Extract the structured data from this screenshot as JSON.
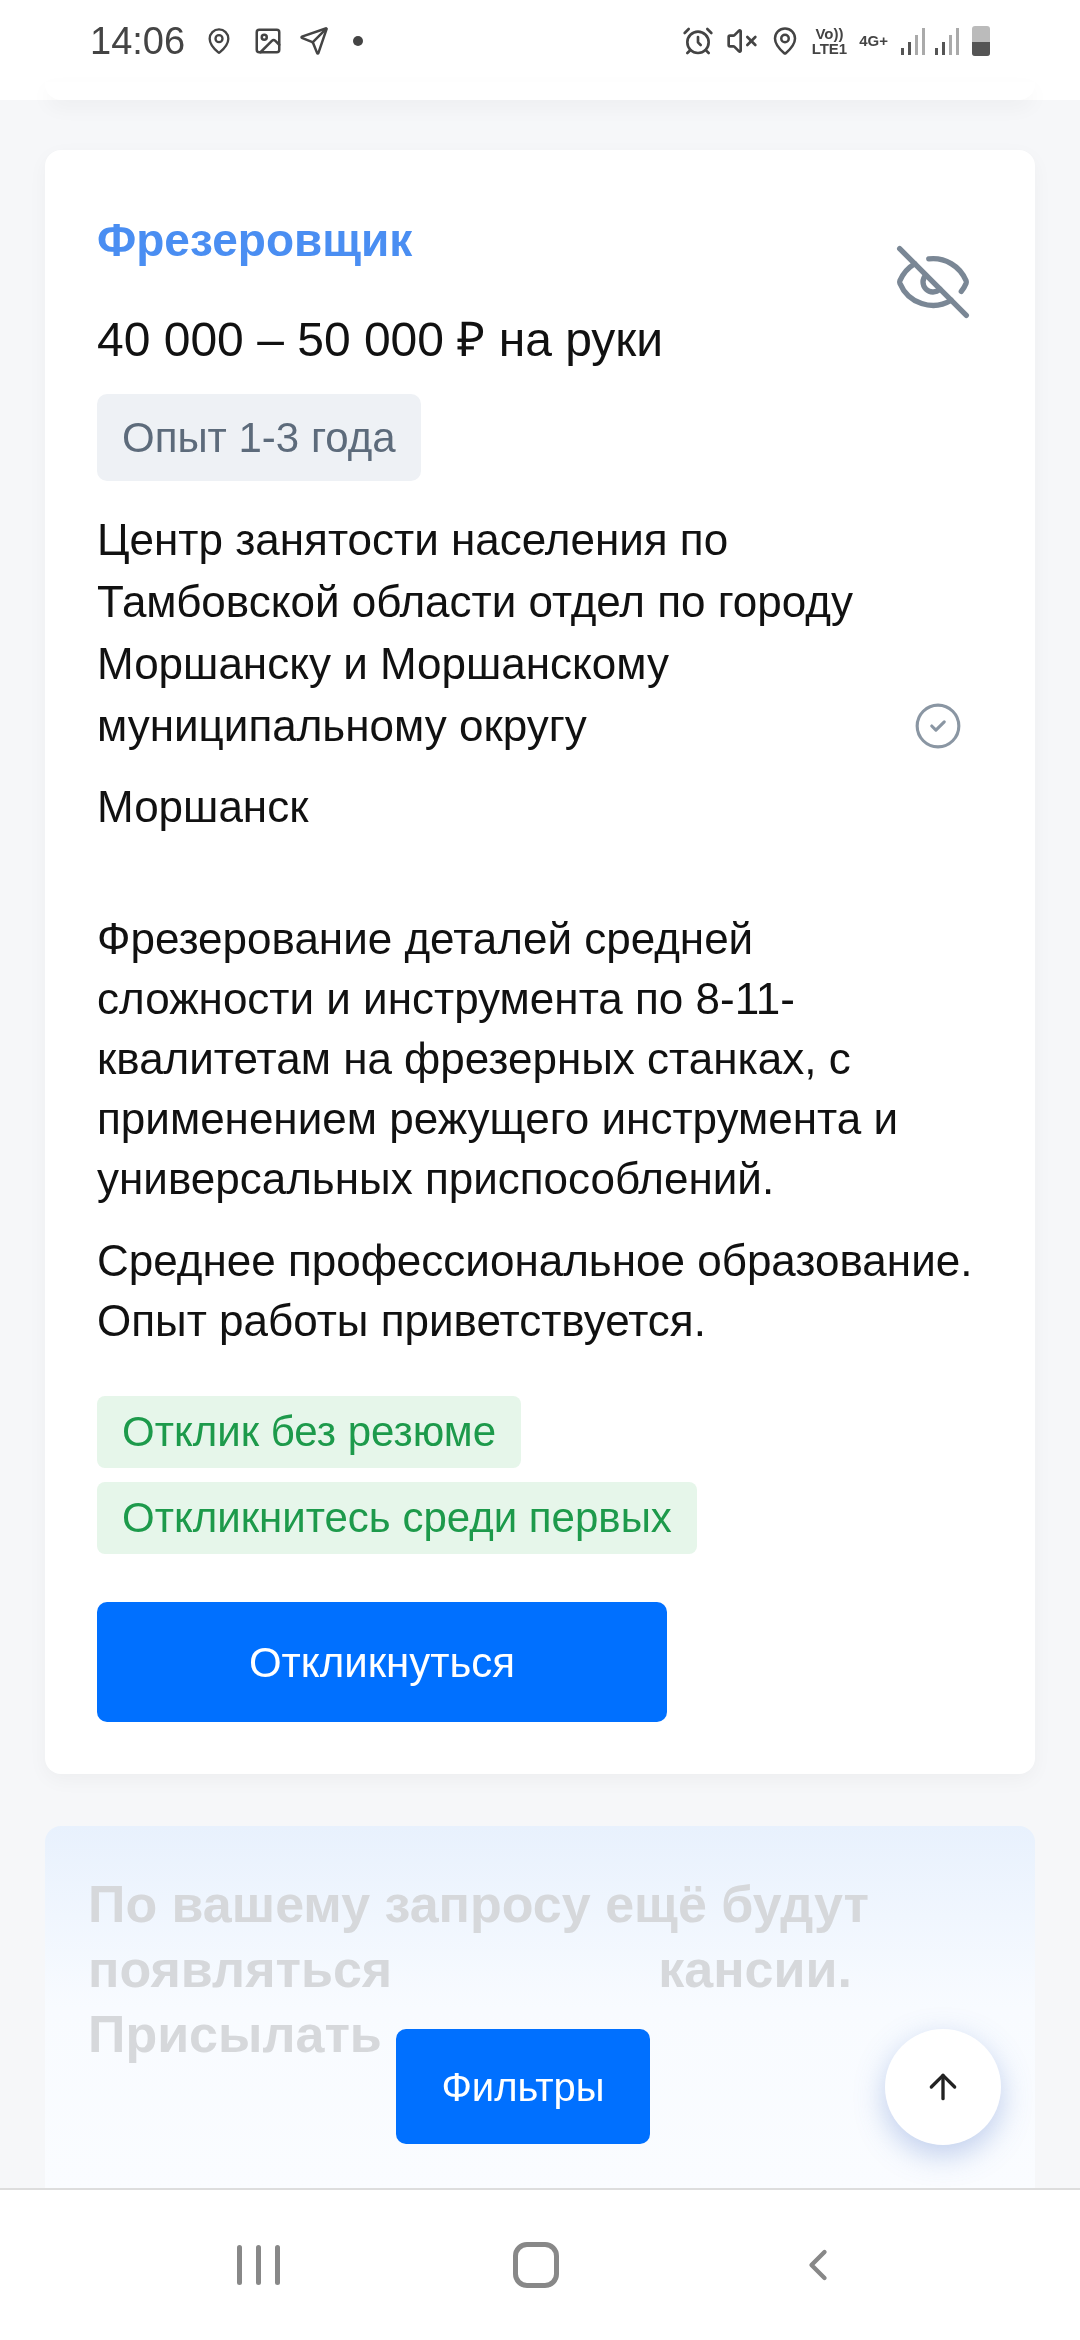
{
  "status_bar": {
    "time": "14:06",
    "volte_top": "Vo))",
    "volte_bottom": "LTE1",
    "network": "4G+"
  },
  "vacancy": {
    "title": "Фрезеровщик",
    "salary": "40 000 – 50 000 ₽ на руки",
    "experience": "Опыт 1-3 года",
    "company": "Центр занятости населения по Тамбовской области отдел по городу Моршанску и Моршанскому муниципальному округу",
    "company_verified": true,
    "city": "Моршанск",
    "description": "Фрезерование деталей средней сложности и инструмента по 8-11-квалитетам на фрезерных станках, с применением режущего инструмента и универсальных приспособлений.",
    "requirements": "Среднее профессиональное образование. Опыт работы приветствуется.",
    "tags": [
      "Отклик без резюме",
      "Откликнитесь среди первых"
    ],
    "apply_button": "Откликнуться"
  },
  "subscription_banner": {
    "lines": [
      [
        "По вашему запросу ещё будут"
      ],
      [
        "появляться",
        "кансии."
      ],
      [
        "Присылать"
      ]
    ]
  },
  "filters_button": "Фильтры"
}
